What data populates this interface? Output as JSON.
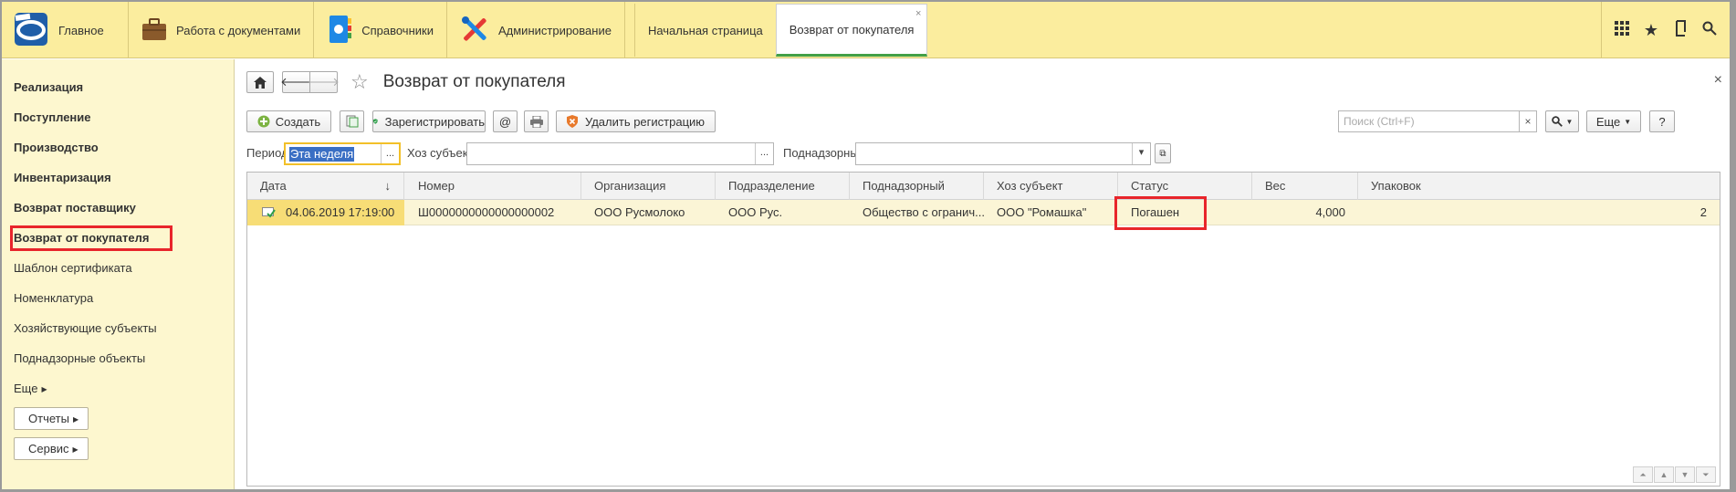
{
  "topbar": {
    "home_label": "Главное",
    "sections": [
      {
        "label": "Работа с документами",
        "icon": "briefcase-icon"
      },
      {
        "label": "Справочники",
        "icon": "phonebook-icon"
      },
      {
        "label": "Администрирование",
        "icon": "tools-icon"
      }
    ],
    "tabs": [
      {
        "label": "Начальная страница",
        "active": false
      },
      {
        "label": "Возврат от покупателя",
        "active": true,
        "close": "×"
      }
    ],
    "right_icons": [
      "apps-grid-icon",
      "favorites-star-icon",
      "history-icon",
      "search-icon"
    ]
  },
  "sidebar": {
    "items": [
      {
        "label": "Реализация",
        "bold": true
      },
      {
        "label": "Поступление",
        "bold": true
      },
      {
        "label": "Производство",
        "bold": true
      },
      {
        "label": "Инвентаризация",
        "bold": true
      },
      {
        "label": "Возврат поставщику",
        "bold": true
      },
      {
        "label": "Возврат от покупателя",
        "bold": true,
        "highlighted": true
      },
      {
        "label": "Шаблон сертификата",
        "bold": false
      },
      {
        "label": "Номенклатура",
        "bold": false
      },
      {
        "label": "Хозяйствующие субъекты",
        "bold": false
      },
      {
        "label": "Поднадзорные объекты",
        "bold": false
      }
    ],
    "more_label": "Еще",
    "reports_label": "Отчеты",
    "service_label": "Сервис"
  },
  "content": {
    "title": "Возврат от покупателя",
    "close": "×",
    "toolbar": {
      "create_label": "Создать",
      "register_label": "Зарегистрировать",
      "email_label": "@",
      "unregister_label": "Удалить регистрацию",
      "search_placeholder": "Поиск (Ctrl+F)",
      "more_label": "Еще",
      "help_label": "?"
    },
    "filters": {
      "period_label": "Период:",
      "period_value": "Эта неделя",
      "subject_label": "Хоз субъект:",
      "subject_value": "",
      "supervised_label": "Поднадзорный:",
      "supervised_value": "",
      "ellipsis": "..."
    },
    "table": {
      "columns": [
        "Дата",
        "Номер",
        "Организация",
        "Подразделение",
        "Поднадзорный",
        "Хоз субъект",
        "Статус",
        "Вес",
        "Упаковок"
      ],
      "sort_indicator": "↓",
      "rows": [
        {
          "date": "04.06.2019 17:19:00",
          "number": "Ш0000000000000000002",
          "org": "ООО Русмолоко",
          "dept": "ООО Рус.",
          "supervised": "Общество с огранич...",
          "subject": "ООО \"Ромашка\"",
          "status": "Погашен",
          "weight": "4,000",
          "packages": "2"
        }
      ]
    }
  },
  "colors": {
    "topbar_bg": "#fbed9e",
    "sidebar_bg": "#fdf7cf",
    "selected_row_bg": "#fbf5d6",
    "highlight_border": "#e8252b",
    "active_tab_underline": "#43a047"
  }
}
